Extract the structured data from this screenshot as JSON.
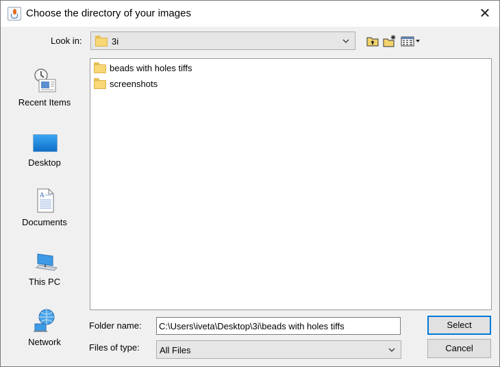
{
  "window": {
    "title": "Choose the directory of your images",
    "close_glyph": "✕"
  },
  "lookin": {
    "label": "Look in:",
    "value": "3i"
  },
  "toolbar": {
    "up_icon": "up-folder-icon",
    "new_folder_icon": "new-folder-icon",
    "view_menu_icon": "view-menu-icon"
  },
  "places": [
    {
      "label": "Recent Items",
      "icon": "recent-items-icon"
    },
    {
      "label": "Desktop",
      "icon": "desktop-icon"
    },
    {
      "label": "Documents",
      "icon": "documents-icon"
    },
    {
      "label": "This PC",
      "icon": "this-pc-icon"
    },
    {
      "label": "Network",
      "icon": "network-icon"
    }
  ],
  "files": [
    {
      "name": "beads with holes tiffs",
      "icon": "folder-icon"
    },
    {
      "name": "screenshots",
      "icon": "folder-icon"
    }
  ],
  "folder_name": {
    "label": "Folder name:",
    "value": "C:\\Users\\iveta\\Desktop\\3i\\beads with holes tiffs"
  },
  "files_of_type": {
    "label": "Files of type:",
    "value": "All Files"
  },
  "buttons": {
    "select": "Select",
    "cancel": "Cancel"
  },
  "colors": {
    "accent": "#0078d7",
    "folder": "#f8d775"
  }
}
